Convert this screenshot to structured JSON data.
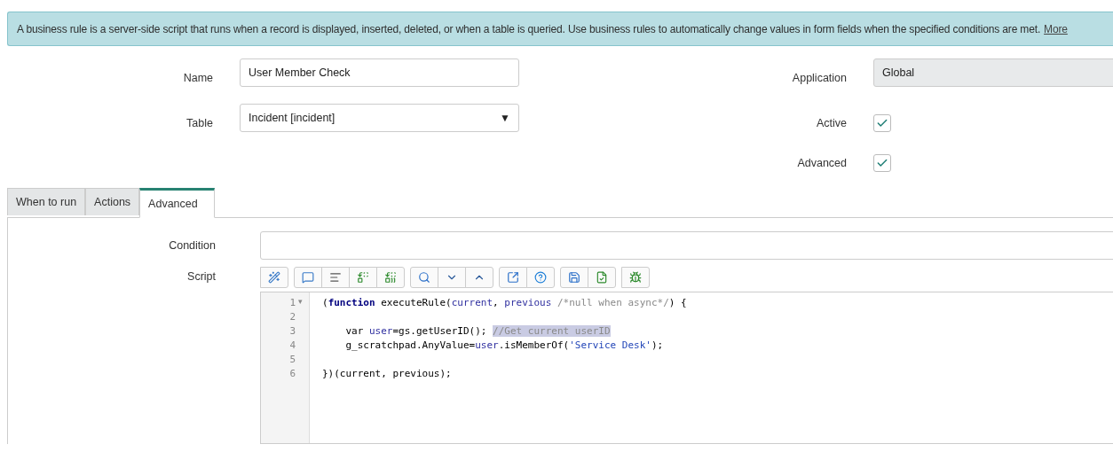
{
  "info_banner": {
    "text": "A business rule is a server-side script that runs when a record is displayed, inserted, deleted, or when a table is queried. Use business rules to automatically change values in form fields when the specified conditions are met.",
    "link": "More"
  },
  "form": {
    "name": {
      "label": "Name",
      "value": "User Member Check"
    },
    "table": {
      "label": "Table",
      "value": "Incident [incident]",
      "caret": "▼"
    },
    "application": {
      "label": "Application",
      "value": "Global"
    },
    "active": {
      "label": "Active",
      "checked": true
    },
    "advanced": {
      "label": "Advanced",
      "checked": true
    }
  },
  "tabs": [
    {
      "label": "When to run",
      "selected": false
    },
    {
      "label": "Actions",
      "selected": false
    },
    {
      "label": "Advanced",
      "selected": true
    }
  ],
  "condition": {
    "label": "Condition"
  },
  "script": {
    "label": "Script",
    "lines": [
      {
        "number": "1",
        "fold": "▾",
        "tokens": [
          {
            "text": "(",
            "kind": "plain"
          },
          {
            "text": "function",
            "kind": "keyword"
          },
          {
            "text": " executeRule(",
            "kind": "plain"
          },
          {
            "text": "current",
            "kind": "variable"
          },
          {
            "text": ", ",
            "kind": "plain"
          },
          {
            "text": "previous",
            "kind": "variable"
          },
          {
            "text": " /*null when async*/",
            "kind": "comment"
          },
          {
            "text": ") {",
            "kind": "plain"
          }
        ]
      },
      {
        "number": "2"
      },
      {
        "number": "3",
        "tokens": [
          {
            "text": "    var ",
            "kind": "plain"
          },
          {
            "text": "user",
            "kind": "variable"
          },
          {
            "text": "=gs.getUserID(); ",
            "kind": "plain"
          },
          {
            "text": "//Get current userID",
            "kind": "selection"
          }
        ]
      },
      {
        "number": "4",
        "tokens": [
          {
            "text": "    g_scratchpad.AnyValue=",
            "kind": "plain"
          },
          {
            "text": "user",
            "kind": "variable"
          },
          {
            "text": ".isMemberOf(",
            "kind": "plain"
          },
          {
            "text": "'Service Desk'",
            "kind": "string"
          },
          {
            "text": ");",
            "kind": "plain"
          }
        ]
      },
      {
        "number": "5"
      },
      {
        "number": "6",
        "tokens": [
          {
            "text": "})(current, previous);",
            "kind": "plain"
          }
        ]
      }
    ]
  }
}
